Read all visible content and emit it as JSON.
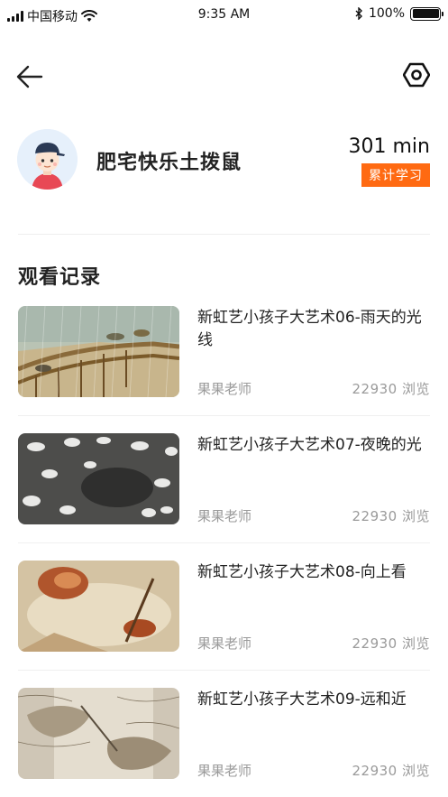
{
  "status_bar": {
    "carrier": "中国移动",
    "time": "9:35 AM",
    "battery": "100%"
  },
  "nav": {
    "back_icon": "arrow-left-icon",
    "settings_icon": "hexagon-settings-icon"
  },
  "profile": {
    "name": "肥宅快乐土拨鼠",
    "minutes": "301 min",
    "badge": "累计学习"
  },
  "history": {
    "title": "观看记录",
    "items": [
      {
        "title": "新虹艺小孩子大艺术06-雨天的光线",
        "teacher": "果果老师",
        "views": "22930  浏览"
      },
      {
        "title": "新虹艺小孩子大艺术07-夜晚的光",
        "teacher": "果果老师",
        "views": "22930  浏览"
      },
      {
        "title": "新虹艺小孩子大艺术08-向上看",
        "teacher": "果果老师",
        "views": "22930  浏览"
      },
      {
        "title": "新虹艺小孩子大艺术09-远和近",
        "teacher": "果果老师",
        "views": "22930  浏览"
      }
    ]
  },
  "colors": {
    "accent": "#ff6a12",
    "muted_text": "#9a9a9a"
  }
}
